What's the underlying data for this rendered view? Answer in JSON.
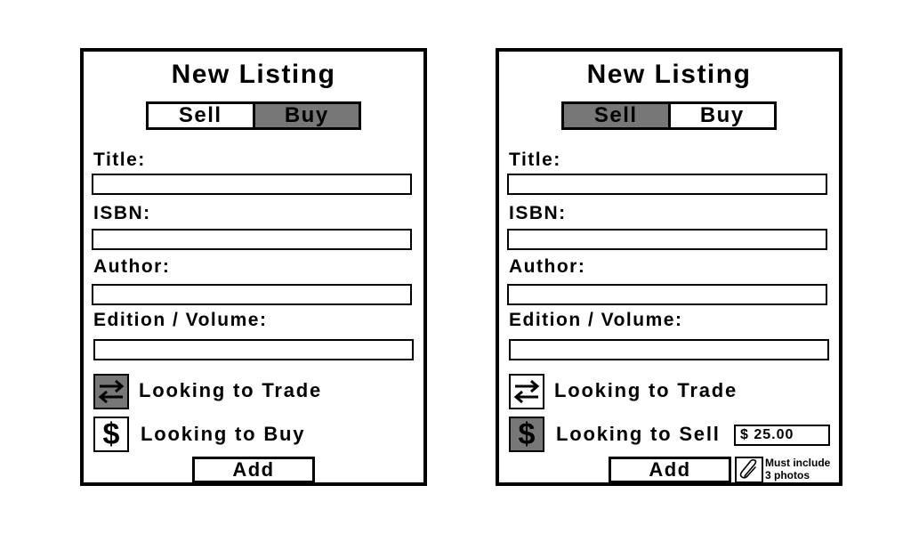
{
  "left": {
    "title": "New Listing",
    "toggle": {
      "sell_label": "Sell",
      "buy_label": "Buy",
      "active": "buy"
    },
    "fields": {
      "title_label": "Title:",
      "isbn_label": "ISBN:",
      "author_label": "Author:",
      "edition_label": "Edition / Volume:"
    },
    "options": {
      "trade_label": "Looking to Trade",
      "buy_label": "Looking to Buy"
    },
    "add_label": "Add"
  },
  "right": {
    "title": "New Listing",
    "toggle": {
      "sell_label": "Sell",
      "buy_label": "Buy",
      "active": "sell"
    },
    "fields": {
      "title_label": "Title:",
      "isbn_label": "ISBN:",
      "author_label": "Author:",
      "edition_label": "Edition / Volume:"
    },
    "options": {
      "trade_label": "Looking to Trade",
      "sell_label": "Looking to Sell",
      "price_value": "$ 25.00"
    },
    "add_label": "Add",
    "attachment_note_line1": "Must include",
    "attachment_note_line2": "3 photos"
  },
  "icons": {
    "trade": "swap-arrows-icon",
    "dollar": "dollar-icon",
    "attach": "paperclip-icon",
    "dollar_glyph": "$"
  },
  "colors": {
    "active_fill": "#777777",
    "border": "#000000",
    "background": "#ffffff"
  }
}
